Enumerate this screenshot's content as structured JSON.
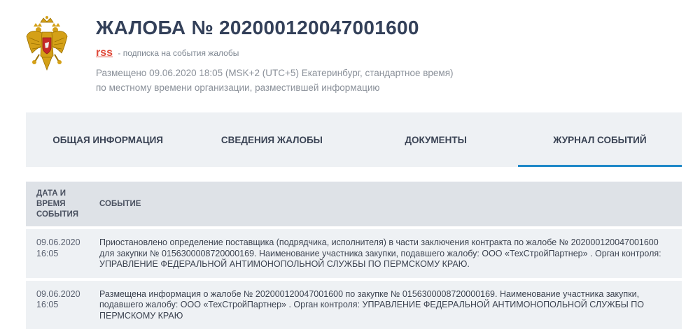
{
  "header": {
    "title": "ЖАЛОБА № 202000120047001600",
    "rss_label": "rss",
    "rss_description": "- подписка на события жалобы",
    "posted_line1": "Размещено 09.06.2020 18:05 (MSK+2 (UTC+5) Екатеринбург, стандартное время)",
    "posted_line2": "по местному времени организации, разместившей информацию"
  },
  "tabs": [
    {
      "label": "ОБЩАЯ ИНФОРМАЦИЯ"
    },
    {
      "label": "СВЕДЕНИЯ ЖАЛОБЫ"
    },
    {
      "label": "ДОКУМЕНТЫ"
    },
    {
      "label": "ЖУРНАЛ СОБЫТИЙ",
      "active": true
    }
  ],
  "table": {
    "columns": [
      "ДАТА И ВРЕМЯ СОБЫТИЯ",
      "СОБЫТИЕ"
    ],
    "rows": [
      {
        "date": "09.06.2020",
        "time": "16:05",
        "event": "Приостановлено определение поставщика (подрядчика, исполнителя) в части заключения контракта по жалобе № 202000120047001600 для закупки № 0156300008720000169. Наименование участника закупки, подавшего жалобу: ООО «ТехСтройПартнер» . Орган контроля: УПРАВЛЕНИЕ ФЕДЕРАЛЬНОЙ АНТИМОНОПОЛЬНОЙ СЛУЖБЫ ПО ПЕРМСКОМУ КРАЮ."
      },
      {
        "date": "09.06.2020",
        "time": "16:05",
        "event": "Размещена информация о жалобе № 202000120047001600 по закупке № 0156300008720000169. Наименование участника закупки, подавшего жалобу: ООО «ТехСтройПартнер» . Орган контроля: УПРАВЛЕНИЕ ФЕДЕРАЛЬНОЙ АНТИМОНОПОЛЬНОЙ СЛУЖБЫ ПО ПЕРМСКОМУ КРАЮ"
      }
    ]
  },
  "colors": {
    "accent": "#1e88c8",
    "title": "#334059",
    "rss": "#e04a3a",
    "tab_bg": "#eef1f4",
    "header_bg": "#dee2e7"
  },
  "icons": {
    "emblem": "russian-coat-of-arms-icon"
  }
}
